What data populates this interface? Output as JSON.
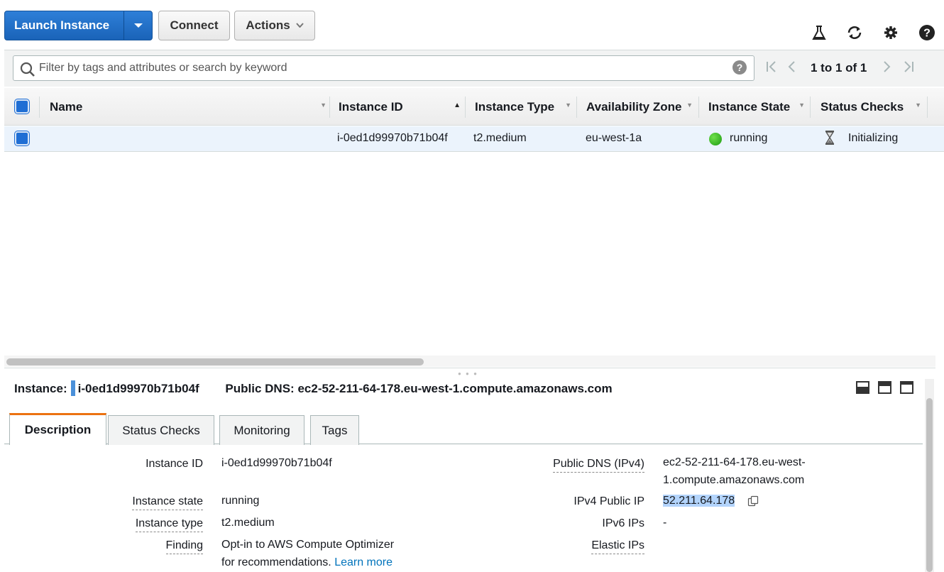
{
  "toolbar": {
    "launch_label": "Launch Instance",
    "connect_label": "Connect",
    "actions_label": "Actions"
  },
  "search": {
    "placeholder": "Filter by tags and attributes or search by keyword",
    "pagination": "1 to 1 of 1"
  },
  "table": {
    "headers": [
      "Name",
      "Instance ID",
      "Instance Type",
      "Availability Zone",
      "Instance State",
      "Status Checks"
    ],
    "rows": [
      {
        "name": "",
        "instance_id": "i-0ed1d99970b71b04f",
        "instance_type": "t2.medium",
        "availability_zone": "eu-west-1a",
        "instance_state": "running",
        "status_checks": "Initializing"
      }
    ]
  },
  "detail": {
    "instance_label": "Instance:",
    "instance_id": "i-0ed1d99970b71b04f",
    "public_dns_label": "Public DNS:",
    "public_dns": "ec2-52-211-64-178.eu-west-1.compute.amazonaws.com",
    "tabs": [
      "Description",
      "Status Checks",
      "Monitoring",
      "Tags"
    ],
    "active_tab": "Description",
    "left_fields": [
      {
        "label": "Instance ID",
        "value": "i-0ed1d99970b71b04f"
      },
      {
        "label": "Instance state",
        "value": "running"
      },
      {
        "label": "Instance type",
        "value": "t2.medium"
      },
      {
        "label": "Finding",
        "value": "Opt-in to AWS Compute Optimizer",
        "value2": "for recommendations.",
        "link": "Learn more"
      }
    ],
    "right_fields": [
      {
        "label": "Public DNS (IPv4)",
        "value": "ec2-52-211-64-178.eu-west-",
        "value2": "1.compute.amazonaws.com"
      },
      {
        "label": "IPv4 Public IP",
        "value": "52.211.64.178"
      },
      {
        "label": "IPv6 IPs",
        "value": "-"
      },
      {
        "label": "Elastic IPs",
        "value": ""
      }
    ]
  },
  "colors": {
    "primary_button": "#1a63b8",
    "selected_row": "#ebf3fc",
    "active_tab_accent": "#ec7211",
    "link": "#0073bb",
    "running_status": "#1d9a12"
  }
}
